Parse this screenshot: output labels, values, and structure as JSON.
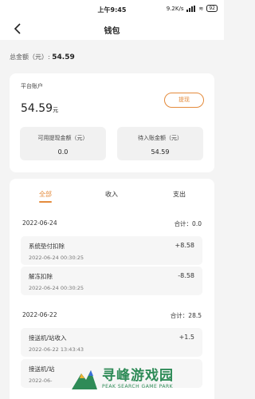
{
  "status_bar": {
    "time": "上午9:45",
    "network_speed": "9.2K/s",
    "battery": "92"
  },
  "header": {
    "title": "钱包"
  },
  "summary": {
    "total_label": "总金额（元）:",
    "total_value": "54.59"
  },
  "account_card": {
    "label": "平台账户",
    "balance": "54.59",
    "unit": "元",
    "withdraw_label": "提现",
    "available_label": "可用提现金额（元）",
    "available_value": "0.0",
    "pending_label": "待入账金额（元）",
    "pending_value": "54.59"
  },
  "tabs": [
    {
      "label": "全部",
      "active": true
    },
    {
      "label": "收入",
      "active": false
    },
    {
      "label": "支出",
      "active": false
    }
  ],
  "groups": [
    {
      "date": "2022-06-24",
      "total": "合计：0.0",
      "items": [
        {
          "name": "系统垫付扣除",
          "time": "2022-06-24 00:30:25",
          "amount": "+8.58"
        },
        {
          "name": "解冻扣除",
          "time": "2022-06-24 00:30:25",
          "amount": "-8.58"
        }
      ]
    },
    {
      "date": "2022-06-22",
      "total": "合计：28.5",
      "items": [
        {
          "name": "接送机/站收入",
          "time": "2022-06-22 13:43:43",
          "amount": "+1.5"
        },
        {
          "name": "接送机/站",
          "time": "2022-06-",
          "amount": ""
        }
      ]
    }
  ],
  "watermark": {
    "text": "寻峰游戏园",
    "sub": "PEAK SEARCH GAME PARK"
  },
  "colors": {
    "accent": "#e48b3c",
    "background": "#f4f4f4",
    "watermark": "#2e8b57"
  }
}
